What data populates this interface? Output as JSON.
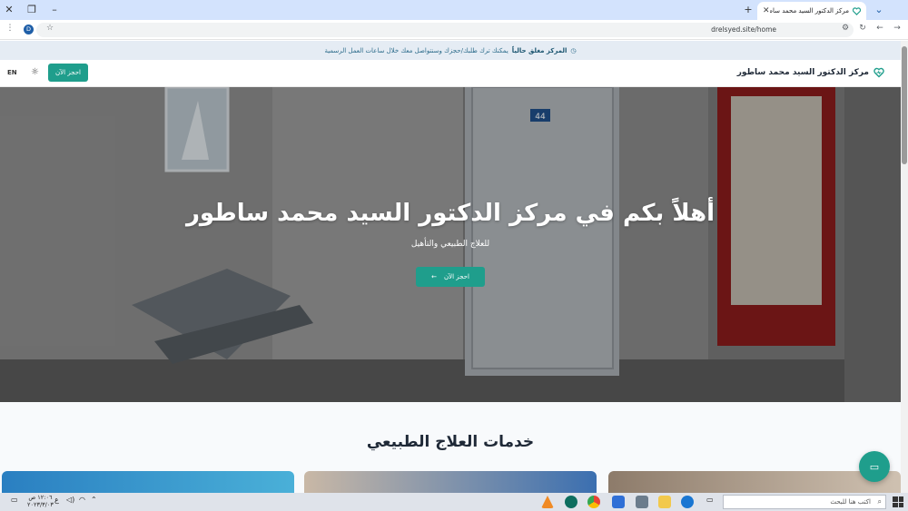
{
  "browser": {
    "tab_title": "مركز الدكتور السيد محمد ساطور",
    "url": "drelsyed.site/home",
    "profile_initial": "D"
  },
  "infobar": {
    "strong": "المركز مغلق حالياً",
    "text": "يمكنك ترك طلبك/حجزك وسنتواصل معك خلال ساعات العمل الرسمية"
  },
  "header": {
    "brand": "مركز الدكتور السيد محمد ساطور",
    "book_label": "احجز الآن",
    "lang_label": "EN"
  },
  "hero": {
    "title": "أهلاً بكم في مركز الدكتور السيد محمد ساطور",
    "subtitle": "للعلاج الطبيعي والتأهيل",
    "button_label": "احجز الآن",
    "door_number": "44"
  },
  "services": {
    "title": "خدمات العلاج الطبيعي"
  },
  "taskbar": {
    "search_placeholder": "اكتب هنا للبحث",
    "time": "١٢:٠٦ ص",
    "date": "٢٠٢٣/٣/٠٣",
    "lang": "ع"
  },
  "colors": {
    "accent": "#1f9e8c",
    "infobar_bg": "#e5ecf4",
    "chrome_tabstrip": "#d3e3fd"
  }
}
